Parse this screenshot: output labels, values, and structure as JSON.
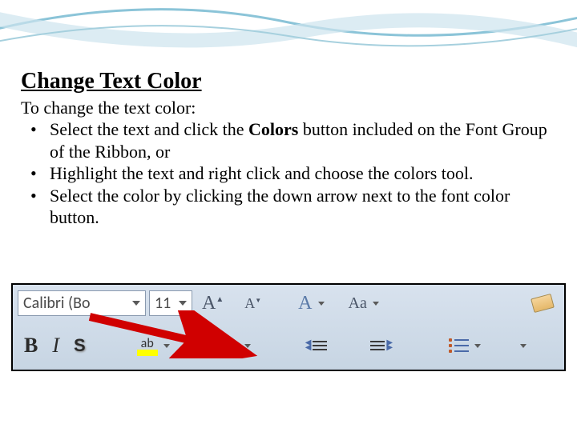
{
  "slide": {
    "title": "Change Text Color",
    "intro": "To change the text color:",
    "bullets": [
      {
        "pre": "Select the text and click the ",
        "bold": "Colors",
        "post": " button included on the Font Group of the Ribbon, or"
      },
      {
        "pre": "Highlight the text and right click and choose the colors tool.",
        "bold": "",
        "post": ""
      },
      {
        "pre": "Select the color by clicking the down arrow next to the font color button.",
        "bold": "",
        "post": ""
      }
    ]
  },
  "toolbar": {
    "font_name": "Calibri (Bo",
    "font_size": "11",
    "highlight_label": "ab"
  }
}
